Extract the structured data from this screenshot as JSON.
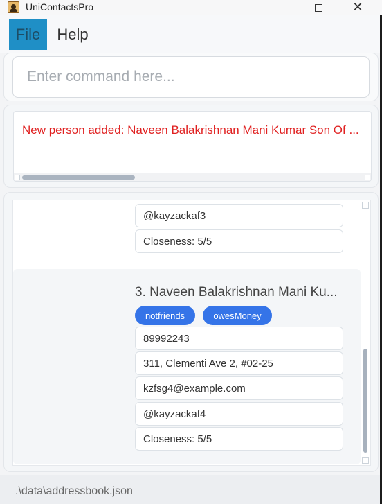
{
  "window": {
    "title": "UniContactsPro",
    "minimize_icon": "minimize-icon",
    "maximize_icon": "maximize-icon",
    "close_icon": "close-icon",
    "close_glyph": "✕"
  },
  "menu": {
    "items": [
      {
        "label": "File"
      },
      {
        "label": "Help"
      }
    ]
  },
  "command": {
    "placeholder": "Enter command here...",
    "value": ""
  },
  "result": {
    "message": "New person added: Naveen Balakrishnan Mani Kumar Son Of ..."
  },
  "list": {
    "previous_card": {
      "fields": [
        "@kayzackaf3",
        "Closeness: 5/5"
      ]
    },
    "current_card": {
      "name": "3. Naveen Balakrishnan Mani Ku...",
      "tags": [
        "notfriends",
        "owesMoney"
      ],
      "phone": "89992243",
      "address": "311, Clementi Ave 2, #02-25",
      "email": "kzfsg4@example.com",
      "telegram": "@kayzackaf4",
      "closeness": "Closeness: 5/5"
    }
  },
  "status": {
    "file_path": ".\\data\\addressbook.json"
  },
  "colors": {
    "accent": "#1f8fc6",
    "tag": "#3574e8",
    "error_text": "#e02020"
  }
}
